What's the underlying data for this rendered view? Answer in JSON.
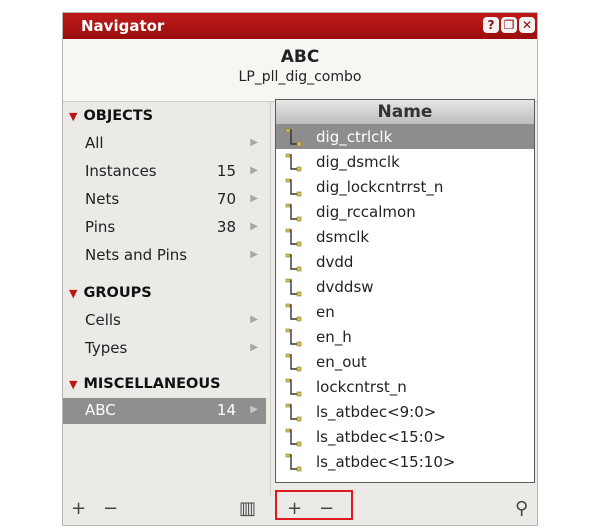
{
  "window": {
    "title": "Navigator",
    "help_btn": "?",
    "restore_btn": "❐",
    "close_btn": "✕"
  },
  "header": {
    "title": "ABC",
    "subtitle": "LP_pll_dig_combo"
  },
  "left": {
    "sections": [
      {
        "label": "OBJECTS"
      },
      {
        "label": "GROUPS"
      },
      {
        "label": "MISCELLANEOUS"
      }
    ],
    "objects": [
      {
        "label": "All",
        "count": ""
      },
      {
        "label": "Instances",
        "count": "15"
      },
      {
        "label": "Nets",
        "count": "70"
      },
      {
        "label": "Pins",
        "count": "38"
      },
      {
        "label": "Nets and Pins",
        "count": ""
      }
    ],
    "groups": [
      {
        "label": "Cells",
        "count": ""
      },
      {
        "label": "Types",
        "count": ""
      }
    ],
    "misc": [
      {
        "label": "ABC",
        "count": "14"
      }
    ]
  },
  "list": {
    "column": "Name",
    "items": [
      "dig_ctrlclk",
      "dig_dsmclk",
      "dig_lockcntrrst_n",
      "dig_rccalmon",
      "dsmclk",
      "dvdd",
      "dvddsw",
      "en",
      "en_h",
      "en_out",
      "lockcntrst_n",
      "ls_atbdec<9:0>",
      "ls_atbdec<15:0>",
      "ls_atbdec<15:10>"
    ]
  },
  "bottom": {
    "add": "+",
    "remove": "−",
    "panel": "▥",
    "search": "⚲"
  },
  "colors": {
    "title_bar": "#a91212",
    "selection": "#8f8f8f",
    "highlight_box": "#e01a1a"
  }
}
